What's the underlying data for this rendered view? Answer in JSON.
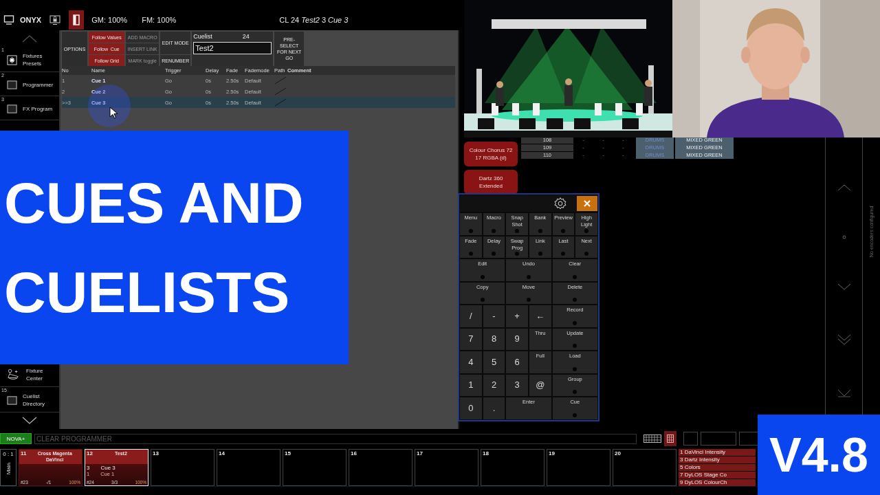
{
  "top_bar": {
    "app_name": "ONYX",
    "grand_master": "GM: 100%",
    "flash_master": "FM: 100%",
    "status": "CL 24 *Test2* 3 *Cue 3*"
  },
  "sidebar": {
    "top_items": [
      {
        "number": "1",
        "label": "Fixtures Presets",
        "kind": "presets"
      },
      {
        "number": "2",
        "label": "Programmer",
        "kind": "window"
      },
      {
        "number": "3",
        "label": "FX Program",
        "kind": "window"
      }
    ],
    "bottom_items": [
      {
        "label": "Fixture Center",
        "kind": "fixture"
      },
      {
        "number": "15",
        "label": "Cuelist Directory",
        "kind": "window"
      }
    ]
  },
  "cuelist": {
    "options": "OPTIONS",
    "follow_buttons": [
      {
        "label": "Follow Values",
        "on": true
      },
      {
        "label": "Follow  Cue",
        "on": true
      },
      {
        "label": "Follow Grid",
        "on": true
      }
    ],
    "action_buttons": [
      {
        "label": "ADD MACRO",
        "disabled": true
      },
      {
        "label": "INSERT LINK",
        "disabled": true
      },
      {
        "label": "MARK toggle",
        "disabled": true
      }
    ],
    "edit_mode": "EDIT MODE",
    "renumber": "RENUMBER",
    "cuelist_label": "Cuelist",
    "cuelist_number": "24",
    "cuelist_name": "Test2",
    "preselect": "PRE-SELECT FOR NEXT GO",
    "columns": [
      {
        "label": "No",
        "bold": false
      },
      {
        "label": "Name",
        "bold": false
      },
      {
        "label": "Trigger",
        "bold": false
      },
      {
        "label": "Delay",
        "bold": false
      },
      {
        "label": "Fade",
        "bold": false
      },
      {
        "label": "Fademode",
        "bold": false
      },
      {
        "label": "Path",
        "bold": false
      },
      {
        "label": "Comment",
        "bold": true
      }
    ],
    "rows": [
      {
        "no": "1",
        "name": "Cue 1",
        "trigger": "Go",
        "delay": "0s",
        "fade": "2.50s",
        "fademode": "Default",
        "selected": false
      },
      {
        "no": "2",
        "name": "Cue 2",
        "trigger": "Go",
        "delay": "0s",
        "fade": "2.50s",
        "fademode": "Default",
        "selected": false
      },
      {
        "no": ">>3",
        "name": "Cue 3",
        "trigger": "Go",
        "delay": "0s",
        "fade": "2.50s",
        "fademode": "Default",
        "selected": true
      }
    ]
  },
  "fixture_buttons": [
    {
      "label": "Colour Chorus 72 17 RGBA (d)"
    },
    {
      "label": "Dartz 360 Extended"
    }
  ],
  "channel_rows": [
    {
      "channel": "108",
      "values": [
        "-",
        "-",
        "-"
      ],
      "group": "DRUMS",
      "preset": "MIXED GREEN"
    },
    {
      "channel": "109",
      "values": [
        "-",
        "-",
        "-"
      ],
      "group": "DRUMS",
      "preset": "MIXED GREEN"
    },
    {
      "channel": "110",
      "values": [
        "-",
        "-",
        "-"
      ],
      "group": "DRUMS",
      "preset": "MIXED GREEN"
    }
  ],
  "encoders": {
    "message": "No encoders configured"
  },
  "keypad": {
    "keys": [
      {
        "label": "Menu",
        "kind": "fn"
      },
      {
        "label": "Macro",
        "kind": "fn"
      },
      {
        "label": "Snap Shot",
        "kind": "fn"
      },
      {
        "label": "Bank",
        "kind": "fn"
      },
      {
        "label": "Preview",
        "kind": "fn"
      },
      {
        "label": "High Light",
        "kind": "fn"
      },
      {
        "label": "Fade",
        "kind": "fn"
      },
      {
        "label": "Delay",
        "kind": "fn"
      },
      {
        "label": "Swap Prog",
        "kind": "fn"
      },
      {
        "label": "Link",
        "kind": "fn"
      },
      {
        "label": "Last",
        "kind": "fn"
      },
      {
        "label": "Next",
        "kind": "fn"
      },
      {
        "label": "Edit",
        "kind": "wide"
      },
      {
        "label": "Undo",
        "kind": "wide"
      },
      {
        "label": "Clear",
        "kind": "wide"
      },
      {
        "label": "Copy",
        "kind": "wide"
      },
      {
        "label": "Move",
        "kind": "wide"
      },
      {
        "label": "Delete",
        "kind": "wide"
      },
      {
        "label": "/",
        "kind": "num"
      },
      {
        "label": "-",
        "kind": "num"
      },
      {
        "label": "+",
        "kind": "num"
      },
      {
        "label": "←",
        "kind": "num"
      },
      {
        "label": "Record",
        "kind": "wide"
      },
      {
        "label": "7",
        "kind": "num"
      },
      {
        "label": "8",
        "kind": "num"
      },
      {
        "label": "9",
        "kind": "num"
      },
      {
        "label": "Thru",
        "kind": "op"
      },
      {
        "label": "Update",
        "kind": "wide"
      },
      {
        "label": "4",
        "kind": "num"
      },
      {
        "label": "5",
        "kind": "num"
      },
      {
        "label": "6",
        "kind": "num"
      },
      {
        "label": "Full",
        "kind": "op"
      },
      {
        "label": "Load",
        "kind": "wide"
      },
      {
        "label": "1",
        "kind": "num"
      },
      {
        "label": "2",
        "kind": "num"
      },
      {
        "label": "3",
        "kind": "num"
      },
      {
        "label": "@",
        "kind": "num"
      },
      {
        "label": "Group",
        "kind": "wide"
      },
      {
        "label": "0",
        "kind": "num"
      },
      {
        "label": ".",
        "kind": "num"
      },
      {
        "label": "Enter",
        "kind": "enter"
      },
      {
        "label": "Cue",
        "kind": "wide"
      }
    ]
  },
  "command_bar": {
    "mode_button": "NOVA+",
    "placeholder": "CLEAR PROGRAMMER"
  },
  "playback": {
    "bank": "0 : 1",
    "page": "Main",
    "faders": [
      {
        "number": "11",
        "title": "Cross Magenta DaVinci",
        "active": true,
        "selected": false,
        "id": "#23",
        "count": "-/1",
        "intensity": "100%"
      },
      {
        "number": "12",
        "title": "Test2",
        "active": true,
        "selected": true,
        "current_no": "3",
        "current_name": "Cue 3",
        "next_no": "1",
        "next_name": "Cue 1",
        "id": "#24",
        "count": "3/3",
        "intensity": "100%"
      },
      {
        "number": "13",
        "active": false,
        "selected": false
      },
      {
        "number": "14",
        "active": false,
        "selected": false
      },
      {
        "number": "15",
        "active": false,
        "selected": false
      },
      {
        "number": "16",
        "active": false,
        "selected": false
      },
      {
        "number": "17",
        "active": false,
        "selected": false
      },
      {
        "number": "18",
        "active": false,
        "selected": false
      },
      {
        "number": "19",
        "active": false,
        "selected": false
      },
      {
        "number": "20",
        "active": false,
        "selected": false
      }
    ],
    "quick_list": [
      "1 DaVinci Intensity",
      "3 Dartz Intensity",
      "5 Colors",
      "7 DyLOS Stage Co",
      "9 DyLOS ColourCh"
    ]
  },
  "overlay": {
    "title_lines": [
      "CUES AND",
      "CUELISTS"
    ],
    "version": "V4.8"
  }
}
